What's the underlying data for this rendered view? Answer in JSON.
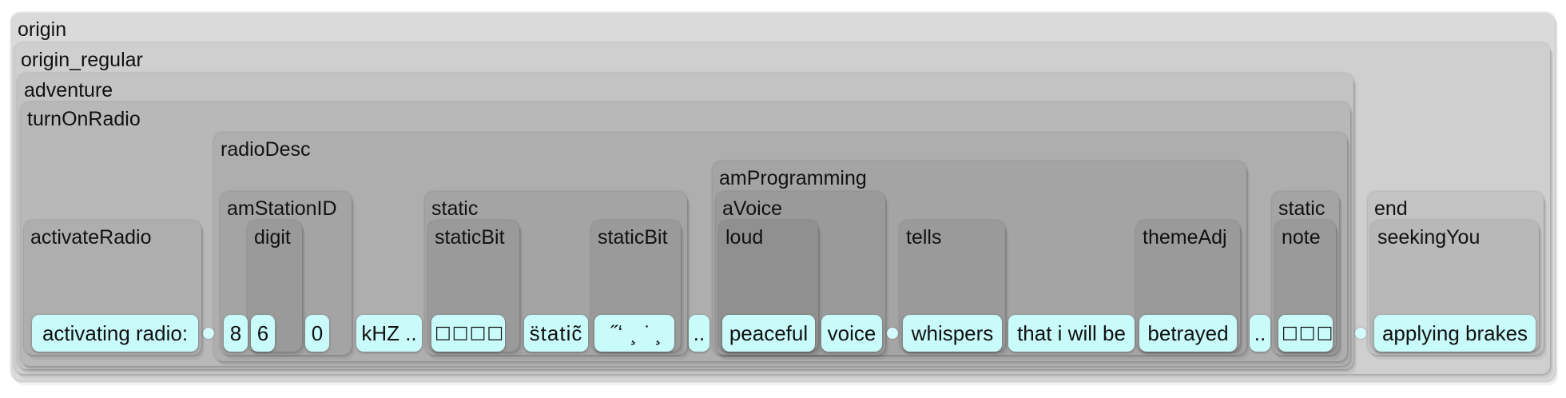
{
  "nodes": {
    "origin": "origin",
    "origin_regular": "origin_regular",
    "adventure": "adventure",
    "turnOnRadio": "turnOnRadio",
    "activateRadio": "activateRadio",
    "radioDesc": "radioDesc",
    "amStationID": "amStationID",
    "digit": "digit",
    "static": "static",
    "staticBit": "staticBit",
    "amProgramming": "amProgramming",
    "aVoice": "aVoice",
    "loud": "loud",
    "tells": "tells",
    "themeAdj": "themeAdj",
    "note": "note",
    "end": "end",
    "seekingYou": "seekingYou"
  },
  "leaves": {
    "activating": "activating radio:",
    "d8": "8",
    "d6": "6",
    "d0": "0",
    "khz": "kHZ ..",
    "boxes4": "□□□□",
    "static_glitch": "s̈tatic̃",
    "noise": "˝ʻ ¸ ˙ ̧",
    "dots1": "..",
    "peaceful": "peaceful",
    "voice": "voice",
    "whispers": "whispers",
    "that_i": "that i will be",
    "betrayed": "betrayed",
    "dots2": "..",
    "boxes3": "□□□",
    "brakes": "applying brakes"
  },
  "colors": {
    "leaf": "#c9fbfb"
  }
}
